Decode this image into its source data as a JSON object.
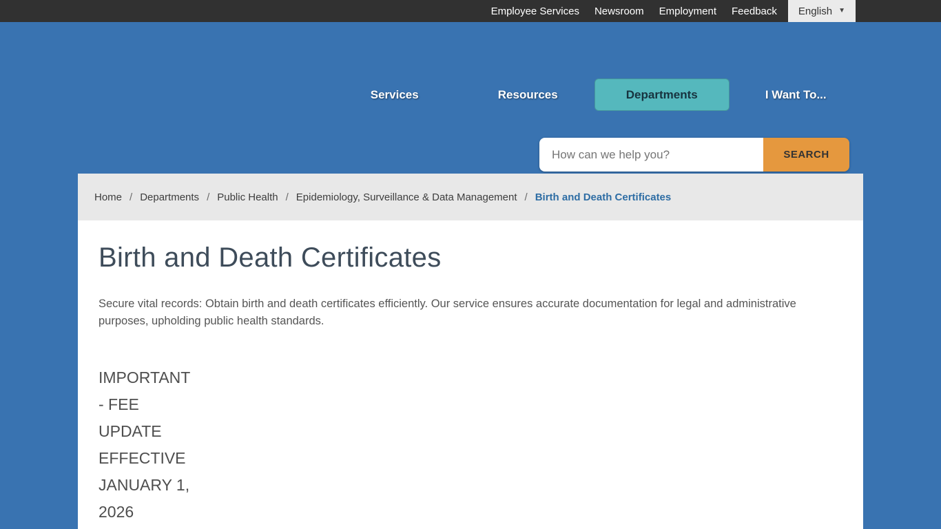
{
  "topbar": {
    "links": [
      "Employee Services",
      "Newsroom",
      "Employment",
      "Feedback"
    ],
    "language": {
      "label": "English"
    }
  },
  "nav": {
    "items": [
      {
        "label": "Services",
        "active": false
      },
      {
        "label": "Resources",
        "active": false
      },
      {
        "label": "Departments",
        "active": true
      },
      {
        "label": "I Want To...",
        "active": false
      }
    ]
  },
  "search": {
    "placeholder": "How can we help you?",
    "button_label": "SEARCH"
  },
  "breadcrumb": {
    "separator": "/",
    "items": [
      "Home",
      "Departments",
      "Public Health",
      "Epidemiology, Surveillance & Data Management"
    ],
    "current": "Birth and Death Certificates"
  },
  "main": {
    "title": "Birth and Death Certificates",
    "intro": "Secure vital records: Obtain birth and death certificates efficiently. Our service ensures accurate documentation for legal and administrative purposes, upholding public health standards.",
    "notice_lines": [
      "IMPORTANT",
      "- FEE",
      "UPDATE",
      "EFFECTIVE",
      "JANUARY 1,",
      "2026"
    ]
  },
  "colors": {
    "header_blue": "#3973b1",
    "topbar_dark": "#313131",
    "accent_teal": "#55b8bd",
    "accent_orange": "#e5983e",
    "breadcrumb_bg": "#e8e8e8",
    "breadcrumb_current_blue": "#2e6da4"
  }
}
